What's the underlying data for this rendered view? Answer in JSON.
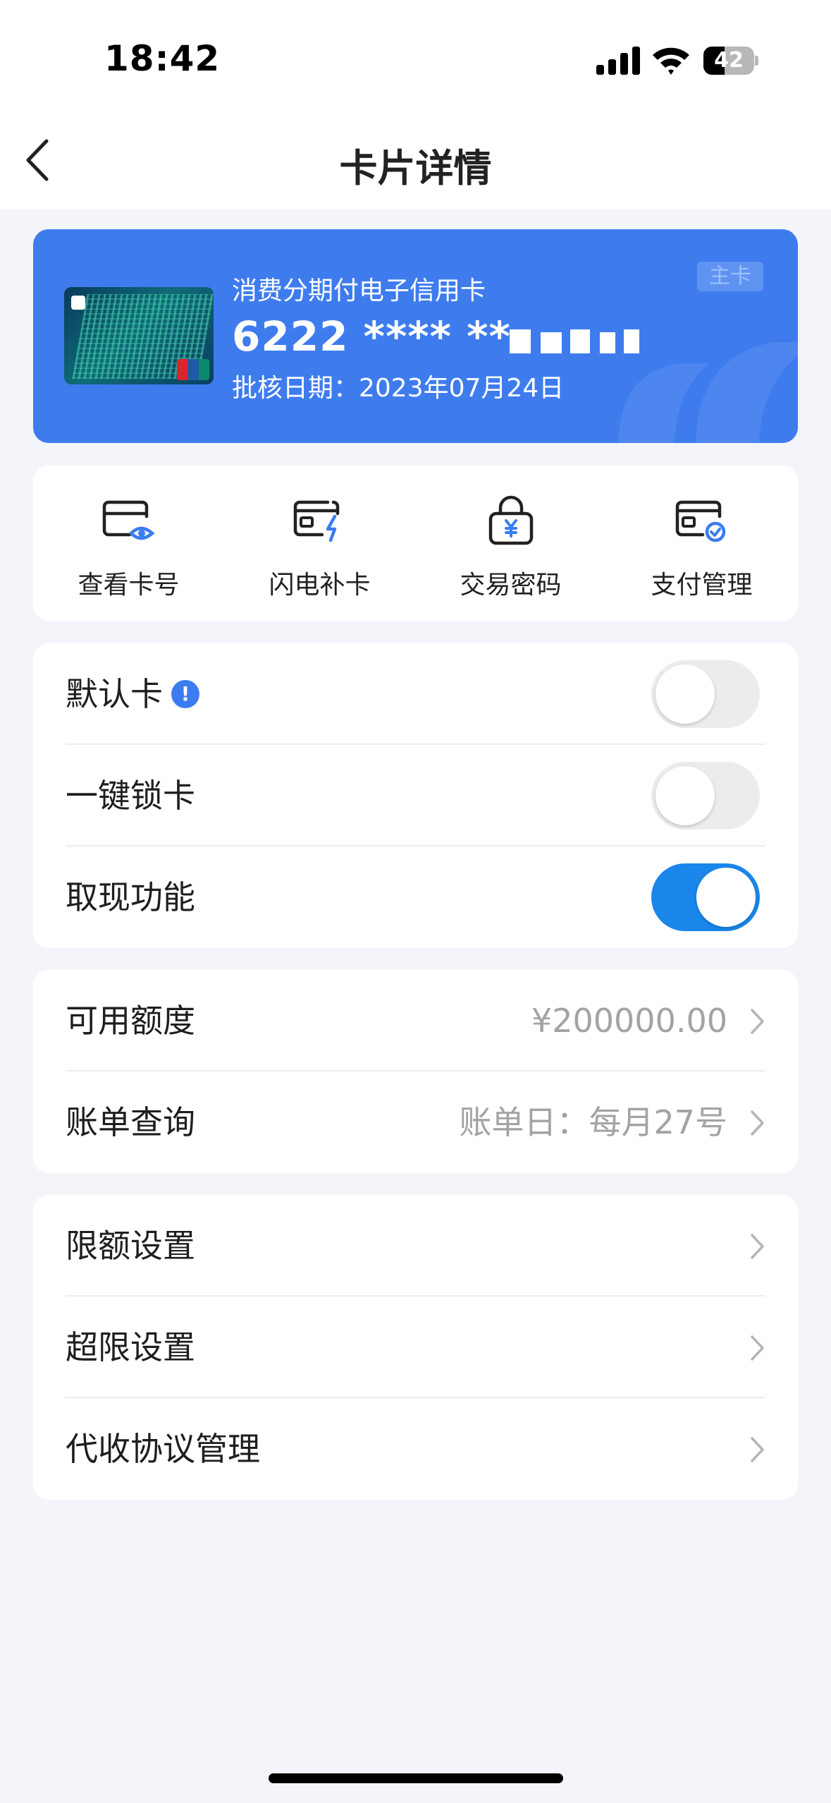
{
  "status_bar": {
    "time": "18:42",
    "battery": "42",
    "battery_level": 0.42
  },
  "header": {
    "title": "卡片详情"
  },
  "card": {
    "name": "消费分期付电子信用卡",
    "number": "6222 **** **",
    "approval_date": "批核日期：2023年07月24日",
    "badge": "主卡"
  },
  "actions": [
    {
      "label": "查看卡号",
      "icon": "card-eye-icon"
    },
    {
      "label": "闪电补卡",
      "icon": "card-lightning-icon"
    },
    {
      "label": "交易密码",
      "icon": "lock-yuan-icon"
    },
    {
      "label": "支付管理",
      "icon": "card-check-icon"
    }
  ],
  "toggles": [
    {
      "label": "默认卡",
      "on": false,
      "info": "!"
    },
    {
      "label": "一键锁卡",
      "on": false
    },
    {
      "label": "取现功能",
      "on": true
    }
  ],
  "account_rows": [
    {
      "label": "可用额度",
      "value": "¥200000.00"
    },
    {
      "label": "账单查询",
      "value": "账单日：每月27号"
    }
  ],
  "settings_rows": [
    {
      "label": "限额设置"
    },
    {
      "label": "超限设置"
    },
    {
      "label": "代收协议管理"
    }
  ],
  "colors": {
    "accent": "#3e7cee",
    "toggle_on": "#1a86ea",
    "background": "#f3f5fa"
  }
}
